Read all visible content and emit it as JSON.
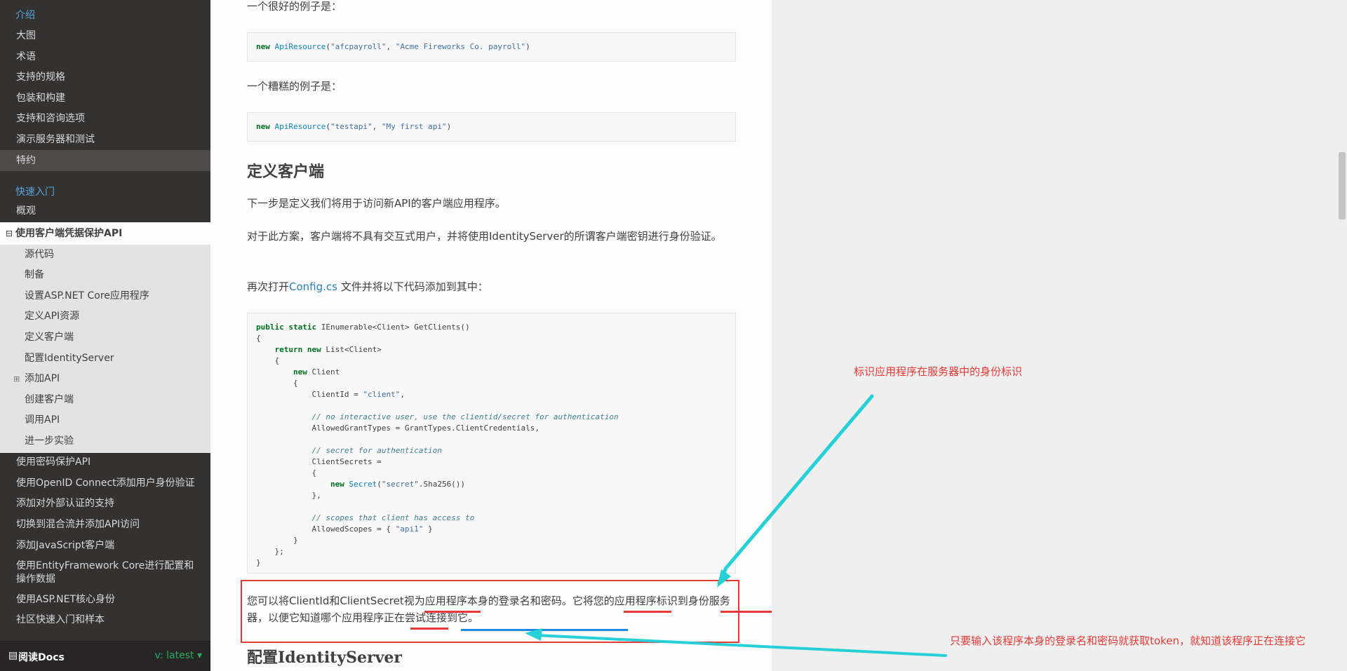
{
  "sidebar": {
    "caption_intro": "介绍",
    "intro_items": [
      "大图",
      "术语",
      "支持的规格",
      "包装和构建",
      "支持和咨询选项",
      "演示服务器和测试",
      "特约"
    ],
    "caption_quickstart": "快速入门",
    "overview": "概观",
    "current": "使用客户端凭据保护API",
    "current_toggle": "⊟",
    "sub_items": [
      "源代码",
      "制备",
      "设置ASP.NET Core应用程序",
      "定义API资源",
      "定义客户端",
      "配置IdentityServer",
      "添加API",
      "创建客户端",
      "调用API",
      "进一步实验"
    ],
    "sub_toggle": "⊞",
    "more_items": [
      "使用密码保护API",
      "使用OpenID Connect添加用户身份验证",
      "添加对外部认证的支持",
      "切换到混合流并添加API访问",
      "添加JavaScript客户端",
      "使用EntityFramework Core进行配置和操作数据",
      "使用ASP.NET核心身份",
      "社区快速入门和样本"
    ],
    "footer_brand": "阅读Docs",
    "footer_version": "v: latest"
  },
  "content": {
    "good_example": "一个很好的例子是：",
    "bad_example": "一个糟糕的例子是：",
    "heading_define_client": "定义客户端",
    "p_next_step": "下一步是定义我们将用于访问新API的客户端应用程序。",
    "p_scenario": "对于此方案，客户端将不具有交互式用户，并将使用IdentityServer的所谓客户端密钥进行身份验证。",
    "p_open_config_prefix": "再次打开",
    "p_open_config_link": "Config.cs",
    "p_open_config_suffix": " 文件并将以下代码添加到其中：",
    "note": "您可以将ClientId和ClientSecret视为应用程序本身的登录名和密码。它将您的应用程序标识到身份服务器，以便它知道哪个应用程序正在尝试连接到它。",
    "heading_config_is": "配置IdentityServer"
  },
  "annotations": {
    "top": "标识应用程序在服务器中的身份标识",
    "bottom": "只要输入该程序本身的登录名和密码就获取token，就知道该程序正在连接它",
    "colors": {
      "text": "#e53935",
      "arrow": "#26d0d6",
      "blue_underline": "#1e88e5"
    }
  }
}
